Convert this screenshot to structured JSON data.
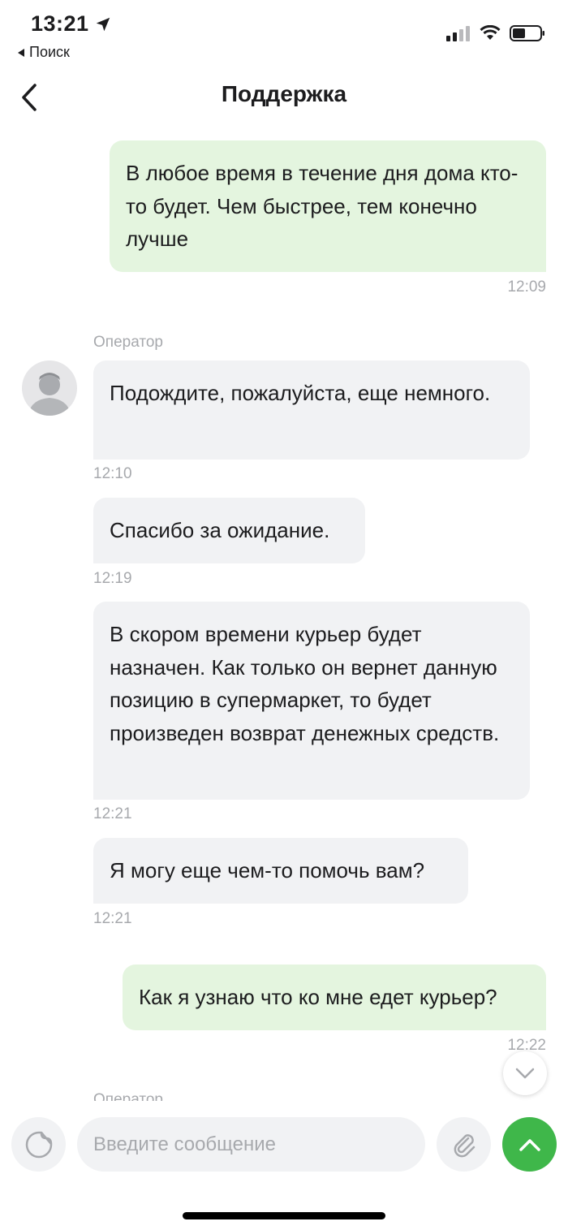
{
  "status_bar": {
    "time": "13:21",
    "back_app": "Поиск"
  },
  "header": {
    "title": "Поддержка"
  },
  "messages": [
    {
      "direction": "out",
      "text": "В любое время в течение дня дома кто-то будет. Чем быстрее, тем конечно лучше",
      "time": "12:09"
    },
    {
      "direction": "in",
      "sender": "Оператор",
      "text": "Подождите, пожалуйста, еще немного.",
      "time": "12:10"
    },
    {
      "direction": "in",
      "text": "Спасибо за ожидание.",
      "time": "12:19"
    },
    {
      "direction": "in",
      "text": "В скором времени курьер будет назначен. Как только он вернет данную позицию в супермаркет, то будет произведен возврат денежных средств.",
      "time": "12:21"
    },
    {
      "direction": "in",
      "text": "Я могу еще чем-то помочь вам?",
      "time": "12:21"
    },
    {
      "direction": "out",
      "text": "Как я узнаю что ко мне едет курьер?",
      "time": "12:22"
    },
    {
      "direction": "in",
      "sender": "Оператор"
    }
  ],
  "composer": {
    "placeholder": "Введите сообщение"
  },
  "colors": {
    "outgoing_bubble": "#e4f5df",
    "incoming_bubble": "#f1f2f4",
    "accent": "#3fb74a"
  },
  "icons": {
    "location": "location-arrow-icon",
    "signal": "cellular-signal-icon",
    "wifi": "wifi-icon",
    "battery": "battery-icon",
    "back": "chevron-left-icon",
    "avatar": "person-silhouette-icon",
    "scroll": "chevron-down-icon",
    "sticker": "sticker-icon",
    "attach": "paperclip-icon",
    "send": "chevron-up-icon"
  }
}
